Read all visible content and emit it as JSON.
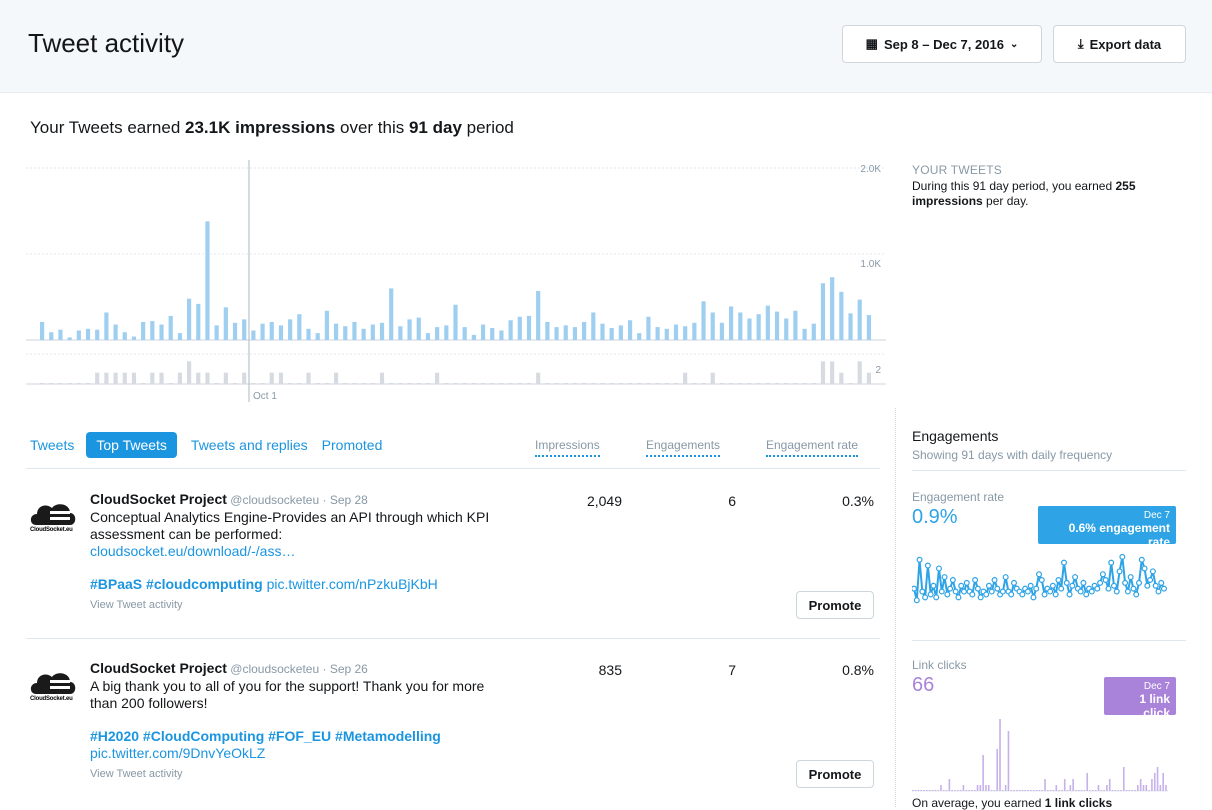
{
  "header": {
    "title": "Tweet activity",
    "date_range": "Sep 8 – Dec 7, 2016",
    "export_label": "Export data"
  },
  "summary": {
    "prefix": "Your Tweets earned ",
    "impressions": "23.1K impressions",
    "middle": " over this ",
    "days": "91 day",
    "suffix": " period"
  },
  "chart_data": {
    "type": "bar",
    "x_tick": "Oct 1",
    "impressions_axis": [
      "2.0K",
      "1.0K"
    ],
    "impressions_ylim": [
      0,
      2000
    ],
    "tweets_axis": "2",
    "tweets_ylim": [
      0,
      3
    ],
    "impressions": [
      210,
      90,
      120,
      30,
      110,
      130,
      120,
      320,
      180,
      90,
      40,
      210,
      220,
      180,
      280,
      80,
      480,
      420,
      1380,
      170,
      380,
      200,
      240,
      110,
      190,
      210,
      170,
      240,
      300,
      130,
      80,
      340,
      190,
      160,
      210,
      130,
      180,
      200,
      600,
      160,
      240,
      260,
      80,
      150,
      170,
      410,
      150,
      60,
      180,
      140,
      110,
      230,
      270,
      280,
      570,
      210,
      150,
      170,
      150,
      210,
      320,
      190,
      140,
      170,
      230,
      80,
      270,
      150,
      130,
      180,
      160,
      200,
      450,
      320,
      200,
      390,
      320,
      250,
      300,
      400,
      330,
      250,
      340,
      130,
      190,
      660,
      730,
      560,
      310,
      470,
      290
    ],
    "tweets": [
      0,
      0,
      0,
      0,
      0,
      0,
      1,
      1,
      1,
      1,
      1,
      0,
      1,
      1,
      0,
      1,
      2,
      1,
      1,
      0,
      1,
      0,
      1,
      0,
      0,
      1,
      1,
      0,
      0,
      1,
      0,
      0,
      1,
      0,
      0,
      0,
      0,
      1,
      0,
      0,
      0,
      0,
      0,
      1,
      0,
      0,
      0,
      0,
      0,
      0,
      0,
      0,
      0,
      0,
      1,
      0,
      0,
      0,
      0,
      0,
      0,
      0,
      0,
      0,
      0,
      0,
      0,
      0,
      0,
      0,
      1,
      0,
      0,
      1,
      0,
      0,
      0,
      0,
      0,
      0,
      0,
      0,
      0,
      0,
      0,
      2,
      2,
      1,
      0,
      2,
      1
    ]
  },
  "your_tweets": {
    "label": "YOUR TWEETS",
    "text_a": "During this 91 day period, you earned ",
    "bold": "255 impressions",
    "text_b": " per day."
  },
  "tabs": [
    "Tweets",
    "Top Tweets",
    "Tweets and replies",
    "Promoted"
  ],
  "columns": [
    "Impressions",
    "Engagements",
    "Engagement rate"
  ],
  "tweets": [
    {
      "avatar_caption": "CloudSocket.eu",
      "name": "CloudSocket Project",
      "handle_date": " @cloudsocketeu · Sep 28",
      "text": "Conceptual Analytics Engine-Provides an API through which KPI assessment can be performed:",
      "link": "cloudsocket.eu/download/-/ass…",
      "tags": "#BPaaS #cloudcomputing",
      "pic": " pic.twitter.com/nPzkuBjKbH",
      "view": "View Tweet activity",
      "impressions": "2,049",
      "engagements": "6",
      "rate": "0.3%",
      "promote": "Promote"
    },
    {
      "avatar_caption": "CloudSocket.eu",
      "name": "CloudSocket Project",
      "handle_date": " @cloudsocketeu · Sep 26",
      "text": "A big thank you to all of you for the support! Thank you for more than 200 followers!",
      "tags": "#H2020 #CloudComputing #FOF_EU #Metamodelling",
      "pic": "pic.twitter.com/9DnvYeOkLZ",
      "view": "View Tweet activity",
      "impressions": "835",
      "engagements": "7",
      "rate": "0.8%",
      "promote": "Promote"
    }
  ],
  "sidebar": {
    "title": "Engagements",
    "subtitle": "Showing 91 days with daily frequency",
    "engagement_rate": {
      "label": "Engagement rate",
      "value": "0.9%",
      "tip_date": "Dec 7",
      "tip_text": "0.6% engagement rate",
      "color": "#2ea3e6",
      "series": [
        0.6,
        0.2,
        1.6,
        0.5,
        0.3,
        1.4,
        0.4,
        0.7,
        0.3,
        1.3,
        0.5,
        1.0,
        0.4,
        0.6,
        0.9,
        0.5,
        0.3,
        0.7,
        0.5,
        0.8,
        0.5,
        0.4,
        0.9,
        0.6,
        0.3,
        0.5,
        0.4,
        0.7,
        0.5,
        0.9,
        0.6,
        0.4,
        0.5,
        1.0,
        0.5,
        0.4,
        0.8,
        0.6,
        0.5,
        0.4,
        0.6,
        0.5,
        0.7,
        0.3,
        0.6,
        1.1,
        0.9,
        0.4,
        0.6,
        0.5,
        0.7,
        0.4,
        0.9,
        0.6,
        1.5,
        0.8,
        0.4,
        0.7,
        1.0,
        0.6,
        0.5,
        0.8,
        0.4,
        0.6,
        0.5,
        0.7,
        0.6,
        0.8,
        1.1,
        0.9,
        0.6,
        1.5,
        0.7,
        0.5,
        1.2,
        1.7,
        0.8,
        0.5,
        1.0,
        0.6,
        0.4,
        0.8,
        1.6,
        1.3,
        0.7,
        0.9,
        1.2,
        0.7,
        0.5,
        0.8,
        0.6
      ]
    },
    "link_clicks": {
      "label": "Link clicks",
      "value": "66",
      "tip_date": "Dec 7",
      "tip_text": "1 link click",
      "color": "#a983d9",
      "series": [
        0,
        0,
        0,
        0,
        0,
        0,
        0,
        0,
        0,
        0,
        1,
        0,
        0,
        2,
        0,
        0,
        0,
        0,
        1,
        0,
        0,
        0,
        0,
        1,
        1,
        6,
        1,
        1,
        0,
        0,
        7,
        12,
        0,
        1,
        10,
        0,
        0,
        0,
        0,
        0,
        0,
        0,
        0,
        0,
        0,
        0,
        0,
        2,
        0,
        0,
        0,
        1,
        0,
        0,
        2,
        0,
        1,
        2,
        0,
        0,
        0,
        0,
        3,
        0,
        0,
        0,
        1,
        0,
        0,
        1,
        2,
        0,
        0,
        0,
        0,
        4,
        0,
        0,
        0,
        0,
        1,
        2,
        1,
        1,
        0,
        2,
        3,
        4,
        1,
        3,
        1
      ]
    },
    "footer_a": "On average, you earned ",
    "footer_bold": "1 link clicks"
  }
}
